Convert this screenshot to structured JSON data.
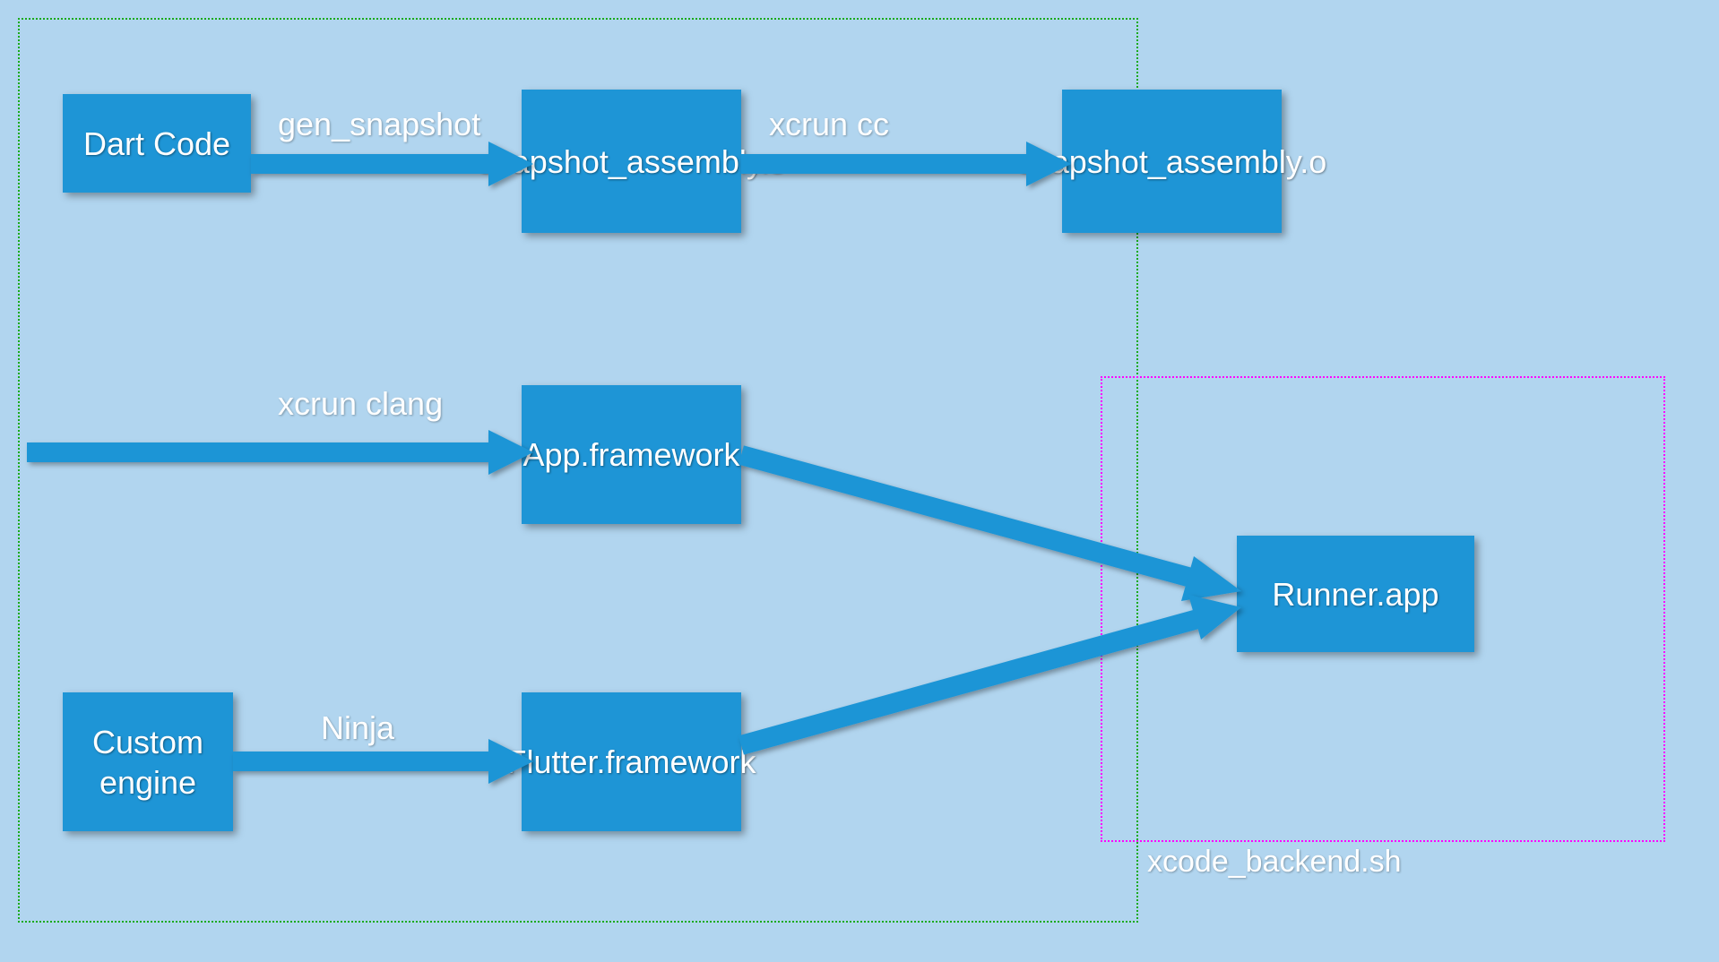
{
  "nodes": {
    "dart_code": "Dart Code",
    "snapshot_s": "snapshot_assembly.s",
    "snapshot_o": "snapshot_assembly.o",
    "app_framework": "App.framework",
    "custom_engine": "Custom engine",
    "flutter_framework": "Flutter.framework",
    "runner_app": "Runner.app"
  },
  "edges": {
    "gen_snapshot": "gen_snapshot",
    "xcrun_cc": "xcrun cc",
    "xcrun_clang": "xcrun clang",
    "ninja": "Ninja"
  },
  "groups": {
    "xcode_backend": "xcode_backend.sh"
  }
}
